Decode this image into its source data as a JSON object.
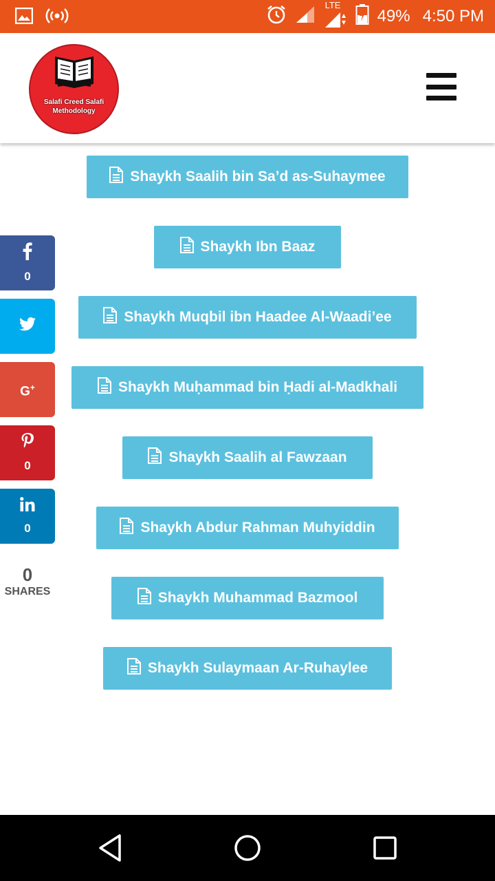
{
  "status_bar": {
    "lte": "LTE",
    "battery": "49%",
    "time": "4:50 PM"
  },
  "header": {
    "logo_text": "Salafi Creed Salafi Methodology"
  },
  "share": {
    "facebook_count": "0",
    "pinterest_count": "0",
    "linkedin_count": "0",
    "total_count": "0",
    "total_label": "SHARES",
    "colors": {
      "facebook": "#3b5998",
      "twitter": "#00aced",
      "googleplus": "#dd4b39",
      "pinterest": "#cb2027",
      "linkedin": "#007bb6"
    }
  },
  "scholars": [
    "Shaykh Saalih bin Sa’d as-Suhaymee",
    "Shaykh Ibn Baaz",
    "Shaykh Muqbil ibn Haadee Al-Waadi’ee",
    "Shaykh Muḥammad bin Ḥadi al-Madkhali",
    "Shaykh Saalih al Fawzaan",
    "Shaykh Abdur Rahman Muhyiddin",
    "Shaykh Muhammad Bazmool",
    "Shaykh Sulaymaan Ar-Ruhaylee"
  ],
  "colors": {
    "status_bar": "#e8541a",
    "button": "#5bc0de",
    "logo": "#e8242b"
  }
}
